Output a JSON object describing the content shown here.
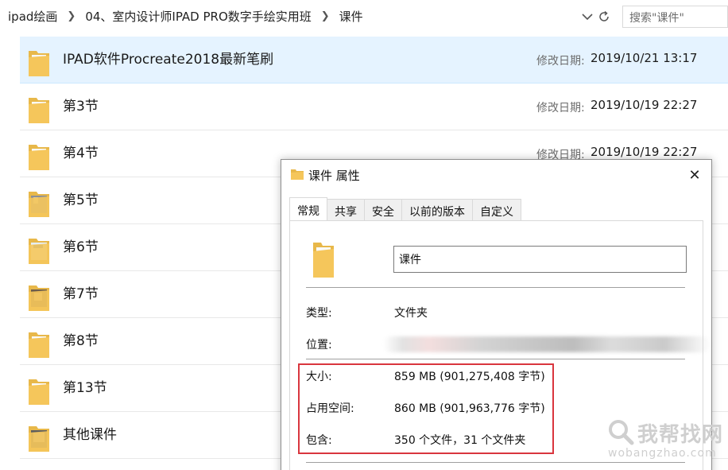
{
  "address": {
    "breadcrumb": [
      "ipad绘画",
      "04、室内设计师IPAD PRO数字手绘实用班",
      "课件"
    ],
    "search_placeholder": "搜索\"课件\""
  },
  "files": [
    {
      "name": "IPAD软件Procreate2018最新笔刷",
      "date_label": "修改日期:",
      "date": "2019/10/21 13:17",
      "selected": true
    },
    {
      "name": "第3节",
      "date_label": "修改日期:",
      "date": "2019/10/19 22:27"
    },
    {
      "name": "第4节",
      "date_label": "修改日期:",
      "date": "2019/10/19 22:27"
    },
    {
      "name": "第5节"
    },
    {
      "name": "第6节"
    },
    {
      "name": "第7节"
    },
    {
      "name": "第8节"
    },
    {
      "name": "第13节"
    },
    {
      "name": "其他课件"
    }
  ],
  "dialog": {
    "title": "课件 属性",
    "tabs": [
      "常规",
      "共享",
      "安全",
      "以前的版本",
      "自定义"
    ],
    "active_tab": "常规",
    "folder_name": "课件",
    "properties": {
      "type_label": "类型:",
      "type_value": "文件夹",
      "location_label": "位置:",
      "size_label": "大小:",
      "size_value": "859 MB (901,275,408 字节)",
      "disk_label": "占用空间:",
      "disk_value": "860 MB (901,963,776 字节)",
      "contains_label": "包含:",
      "contains_value": "350 个文件，31 个文件夹"
    }
  },
  "watermark": {
    "text": "我帮找网",
    "sub": "wobangzhao.com"
  },
  "colors": {
    "selected_row": "#e5f3ff",
    "highlight_border": "#d9363e",
    "folder": "#f5c65b"
  }
}
